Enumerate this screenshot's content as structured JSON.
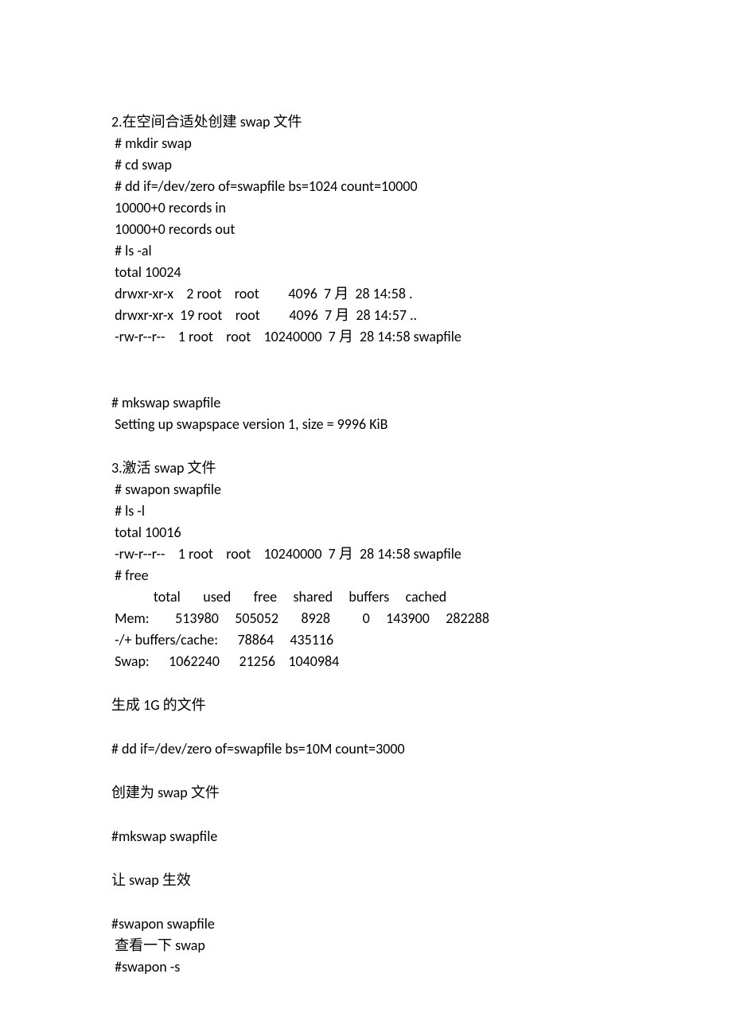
{
  "lines": [
    "2.在空间合适处创建 swap 文件",
    " # mkdir swap",
    " # cd swap",
    " # dd if=/dev/zero of=swapfile bs=1024 count=10000",
    " 10000+0 records in",
    " 10000+0 records out",
    " # ls -al",
    " total 10024",
    " drwxr-xr-x    2 root    root         4096  7 月  28 14:58 .",
    " drwxr-xr-x  19 root    root         4096  7 月  28 14:57 ..",
    " -rw-r--r--    1 root    root    10240000  7 月  28 14:58 swapfile",
    "",
    "",
    "# mkswap swapfile",
    " Setting up swapspace version 1, size = 9996 KiB",
    "",
    "3.激活 swap 文件",
    " # swapon swapfile",
    " # ls -l",
    " total 10016",
    " -rw-r--r--    1 root    root    10240000  7 月  28 14:58 swapfile",
    " # free",
    "             total       used       free     shared     buffers     cached",
    " Mem:        513980     505052       8928          0     143900     282288",
    " -/+ buffers/cache:      78864     435116",
    " Swap:      1062240      21256    1040984",
    "",
    "生成 1G 的文件",
    "",
    "# dd if=/dev/zero of=swapfile bs=10M count=3000",
    "",
    "创建为 swap 文件",
    "",
    "#mkswap swapfile",
    "",
    "让 swap 生效",
    "",
    "#swapon swapfile",
    " 查看一下 swap",
    " #swapon -s"
  ]
}
